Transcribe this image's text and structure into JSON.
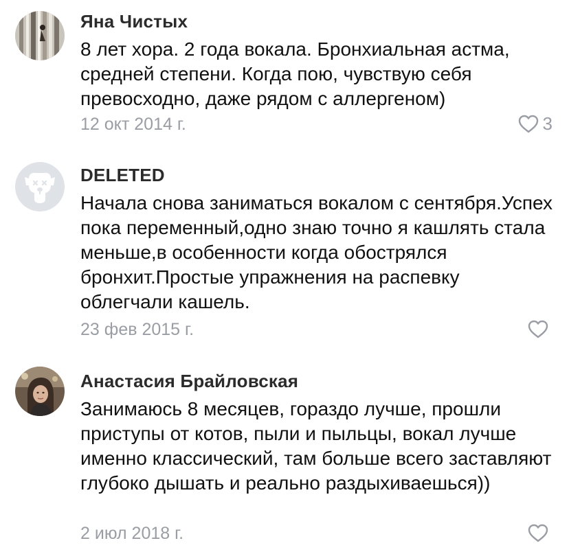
{
  "comments": [
    {
      "author": "Яна Чистых",
      "text": "8 лет хора. 2 года вокала. Бронхиальная астма, средней степени. Когда пою, чувствую себя превосходно, даже рядом с аллергеном)",
      "date": "12 окт 2014 г.",
      "likes": "3",
      "avatar_icon": "profile-photo"
    },
    {
      "author": "DELETED",
      "text": "Начала снова заниматься вокалом с сентября.Успех пока переменный,одно знаю точно я кашлять стала меньше,в особенности когда обострялся бронхит.Простые упражнения на распевку облегчали кашель.",
      "date": "23 фев 2015 г.",
      "likes": "",
      "avatar_icon": "deleted-dog-icon"
    },
    {
      "author": "Анастасия Брайловская",
      "text": "Занимаюсь 8 месяцев, гораздо лучше, прошли приступы от котов, пыли и пыльцы, вокал лучше именно классический, там больше всего заставляют глубоко дышать и реально раздыхиваешься))",
      "date": "2 июл 2018 г.",
      "likes": "",
      "avatar_icon": "profile-photo"
    }
  ],
  "colors": {
    "author": "#2b2b2b",
    "text": "#111111",
    "meta": "#9a9ea4",
    "deleted_avatar_bg": "#dfe2e6"
  }
}
